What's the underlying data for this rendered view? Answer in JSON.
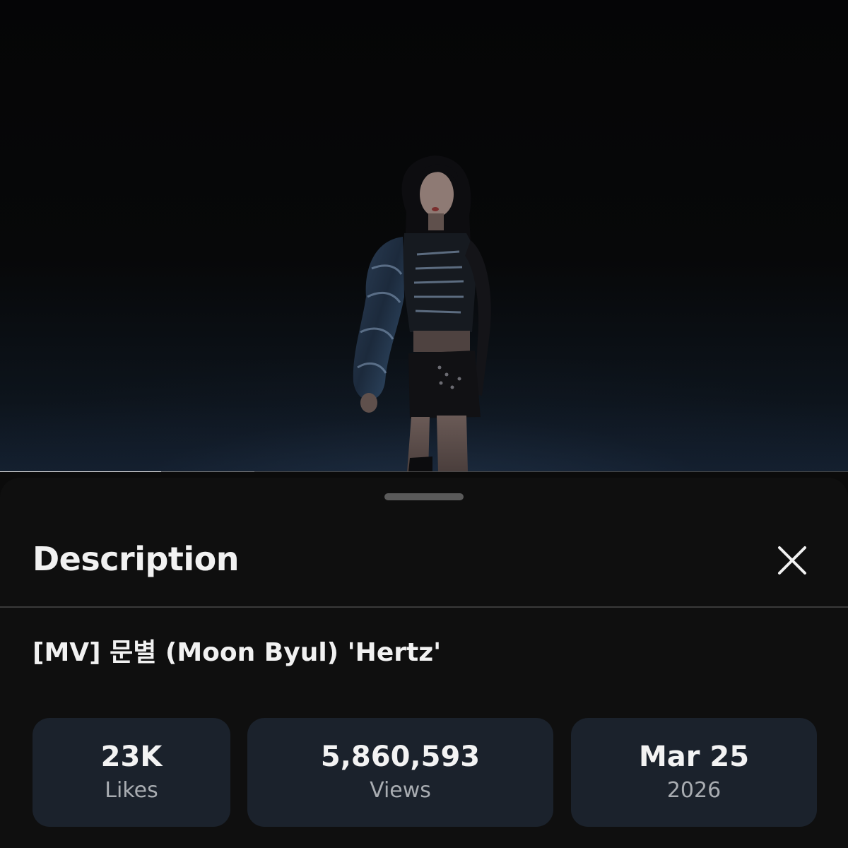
{
  "player": {
    "progress_played": 0.19,
    "progress_buffered": 0.3
  },
  "sheet": {
    "title": "Description",
    "close_icon": "close-icon",
    "video_title": "[MV] 문별 (Moon Byul) 'Hertz'"
  },
  "stats": {
    "likes": {
      "value": "23K",
      "label": "Likes"
    },
    "views": {
      "value": "5,860,593",
      "label": "Views"
    },
    "date": {
      "value": "Mar 25",
      "label": "2026"
    }
  },
  "colors": {
    "sheet_bg": "#0f0f0f",
    "card_bg": "#1b222c",
    "text_primary": "#f1f1f1",
    "text_secondary": "#a9adb2",
    "progress_played": "#e6e6e6"
  }
}
